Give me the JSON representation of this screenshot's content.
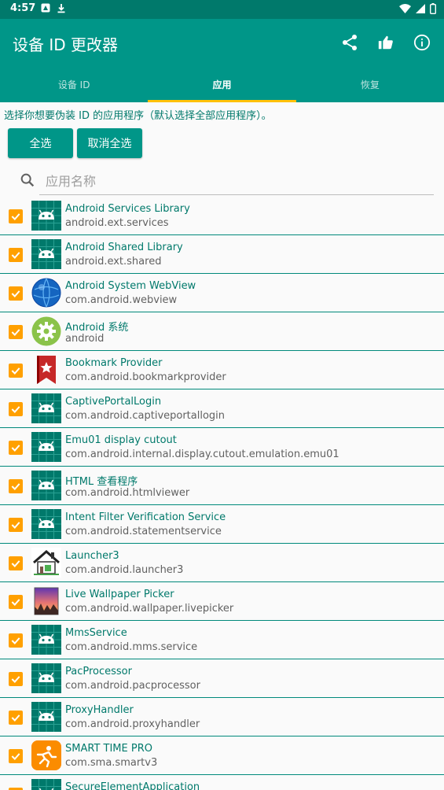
{
  "status_bar": {
    "time": "4:57"
  },
  "app_bar": {
    "title": "设备 ID 更改器"
  },
  "tabs": [
    {
      "label": "设备 ID"
    },
    {
      "label": "应用"
    },
    {
      "label": "恢复"
    }
  ],
  "hint": "选择你想要伪装 ID 的应用程序（默认选择全部应用程序）。",
  "buttons": {
    "select_all": "全选",
    "deselect_all": "取消全选"
  },
  "search": {
    "placeholder": "应用名称",
    "value": ""
  },
  "apps": [
    {
      "name": "Android Services Library",
      "package": "android.ext.services",
      "icon": "android-icon",
      "checked": true
    },
    {
      "name": "Android Shared Library",
      "package": "android.ext.shared",
      "icon": "android-icon",
      "checked": true
    },
    {
      "name": "Android System WebView",
      "package": "com.android.webview",
      "icon": "webview-globe-icon",
      "checked": true
    },
    {
      "name": "Android 系统",
      "package": "android",
      "icon": "gear-icon",
      "checked": true
    },
    {
      "name": "Bookmark Provider",
      "package": "com.android.bookmarkprovider",
      "icon": "bookmark-icon",
      "checked": true
    },
    {
      "name": "CaptivePortalLogin",
      "package": "com.android.captiveportallogin",
      "icon": "android-icon",
      "checked": true
    },
    {
      "name": "Emu01 display cutout",
      "package": "com.android.internal.display.cutout.emulation.emu01",
      "icon": "android-icon",
      "checked": true
    },
    {
      "name": "HTML 查看程序",
      "package": "com.android.htmlviewer",
      "icon": "android-icon",
      "checked": true
    },
    {
      "name": "Intent Filter Verification Service",
      "package": "com.android.statementservice",
      "icon": "android-icon",
      "checked": true
    },
    {
      "name": "Launcher3",
      "package": "com.android.launcher3",
      "icon": "house-icon",
      "checked": true
    },
    {
      "name": "Live Wallpaper Picker",
      "package": "com.android.wallpaper.livepicker",
      "icon": "wallpaper-icon",
      "checked": true
    },
    {
      "name": "MmsService",
      "package": "com.android.mms.service",
      "icon": "android-icon",
      "checked": true
    },
    {
      "name": "PacProcessor",
      "package": "com.android.pacprocessor",
      "icon": "android-icon",
      "checked": true
    },
    {
      "name": "ProxyHandler",
      "package": "com.android.proxyhandler",
      "icon": "android-icon",
      "checked": true
    },
    {
      "name": "SMART TIME PRO",
      "package": "com.sma.smartv3",
      "icon": "smart-time-icon",
      "checked": true
    },
    {
      "name": "SecureElementApplication",
      "package": "",
      "icon": "android-icon",
      "checked": true
    }
  ],
  "colors": {
    "primary": "#009688",
    "primary_dark": "#00796b",
    "accent": "#ffc107",
    "checkbox": "#ffa000"
  }
}
